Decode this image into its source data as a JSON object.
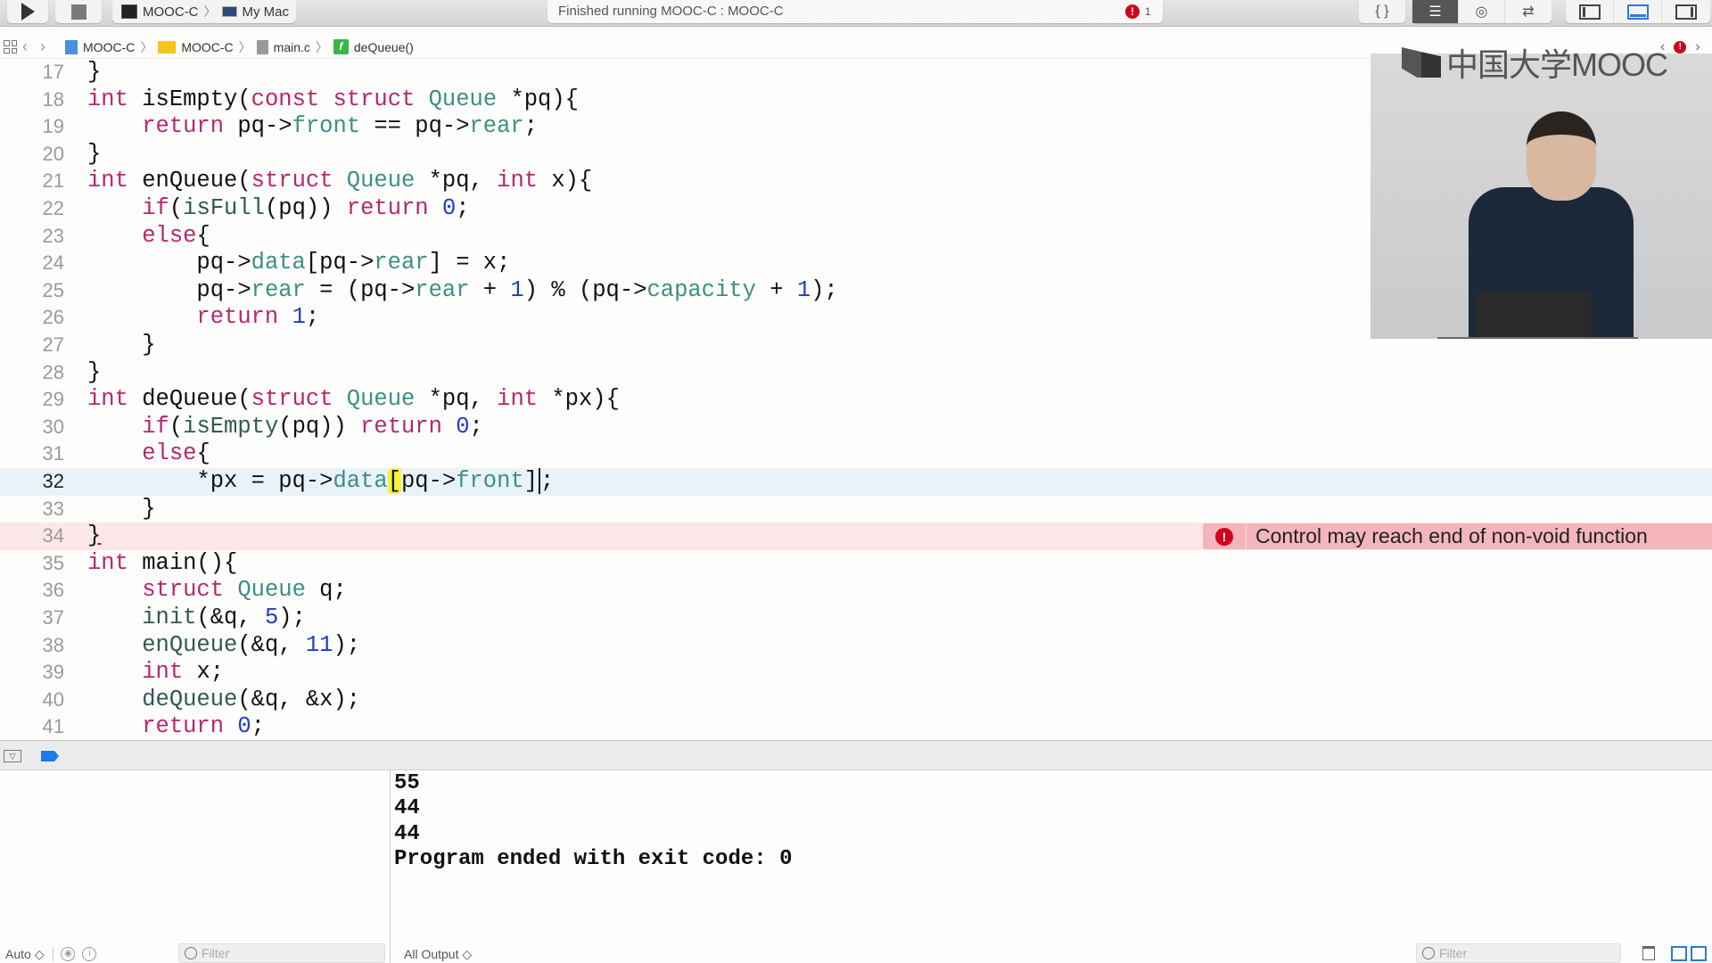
{
  "toolbar": {
    "run_icon": "play-icon",
    "stop_icon": "stop-icon",
    "scheme": "MOOC-C",
    "destination": "My Mac",
    "status": "Finished running MOOC-C : MOOC-C",
    "error_count": "1",
    "editor_modes": [
      "braces-icon",
      "standard-editor-icon",
      "assistant-editor-icon",
      "version-editor-icon"
    ],
    "active_editor_mode": "standard-editor-icon",
    "panel_toggles": [
      "navigator-panel-icon",
      "debug-panel-icon",
      "utilities-panel-icon"
    ],
    "active_panel": "debug-panel-icon"
  },
  "jumpbar": {
    "items": [
      "MOOC-C",
      "MOOC-C",
      "main.c",
      "deQueue()"
    ],
    "func_glyph": "f"
  },
  "editor": {
    "current_line": 32,
    "error_line": 34,
    "lines": [
      {
        "n": "17",
        "html": "}"
      },
      {
        "n": "18",
        "html": "<span class=\"kw\">int</span> isEmpty(<span class=\"kw\">const</span> <span class=\"kw\">struct</span> <span class=\"ty\">Queue</span> *pq){"
      },
      {
        "n": "19",
        "html": "    <span class=\"kw\">return</span> pq-&gt;<span class=\"mem\">front</span> == pq-&gt;<span class=\"mem\">rear</span>;"
      },
      {
        "n": "20",
        "html": "}"
      },
      {
        "n": "21",
        "html": "<span class=\"kw\">int</span> enQueue(<span class=\"kw\">struct</span> <span class=\"ty\">Queue</span> *pq, <span class=\"kw\">int</span> x){"
      },
      {
        "n": "22",
        "html": "    <span class=\"kw\">if</span>(<span class=\"fn\">isFull</span>(pq)) <span class=\"kw\">return</span> <span class=\"num\">0</span>;"
      },
      {
        "n": "23",
        "html": "    <span class=\"kw\">else</span>{"
      },
      {
        "n": "24",
        "html": "        pq-&gt;<span class=\"mem\">data</span>[pq-&gt;<span class=\"mem\">rear</span>] = x;"
      },
      {
        "n": "25",
        "html": "        pq-&gt;<span class=\"mem\">rear</span> = (pq-&gt;<span class=\"mem\">rear</span> + <span class=\"num\">1</span>) % (pq-&gt;<span class=\"mem\">capacity</span> + <span class=\"num\">1</span>);"
      },
      {
        "n": "26",
        "html": "        <span class=\"kw\">return</span> <span class=\"num\">1</span>;"
      },
      {
        "n": "27",
        "html": "    }"
      },
      {
        "n": "28",
        "html": "}"
      },
      {
        "n": "29",
        "html": "<span class=\"kw\">int</span> deQueue(<span class=\"kw\">struct</span> <span class=\"ty\">Queue</span> *pq, <span class=\"kw\">int</span> *px){"
      },
      {
        "n": "30",
        "html": "    <span class=\"kw\">if</span>(<span class=\"fn\">isEmpty</span>(pq)) <span class=\"kw\">return</span> <span class=\"num\">0</span>;"
      },
      {
        "n": "31",
        "html": "    <span class=\"kw\">else</span>{"
      },
      {
        "n": "32",
        "html": "        *px = pq-&gt;<span class=\"mem\">data</span><span class=\"hl\">[</span>pq-&gt;<span class=\"mem\">front</span>]<span class=\"caret\"></span>;"
      },
      {
        "n": "33",
        "html": "    }"
      },
      {
        "n": "34",
        "html": "<span class=\"err-brace\">}</span>"
      },
      {
        "n": "35",
        "html": "<span class=\"kw\">int</span> main(){"
      },
      {
        "n": "36",
        "html": "    <span class=\"kw\">struct</span> <span class=\"ty\">Queue</span> q;"
      },
      {
        "n": "37",
        "html": "    <span class=\"fn\">init</span>(&amp;q, <span class=\"num\">5</span>);"
      },
      {
        "n": "38",
        "html": "    <span class=\"fn\">enQueue</span>(&amp;q, <span class=\"num\">11</span>);"
      },
      {
        "n": "39",
        "html": "    <span class=\"kw\">int</span> x;"
      },
      {
        "n": "40",
        "html": "    <span class=\"fn\">deQueue</span>(&amp;q, &amp;x);"
      },
      {
        "n": "41",
        "html": "    <span class=\"kw\">return</span> <span class=\"num\">0</span>;"
      }
    ],
    "issue": {
      "icon": "error-icon",
      "message": "Control may reach end of non-void function"
    }
  },
  "video_overlay": {
    "logo_text": "中国大学MOOC"
  },
  "debug": {
    "console_output": [
      "55",
      "44",
      "44",
      "Program ended with exit code: 0"
    ],
    "variables_scope": "Auto ◇",
    "variables_filter_placeholder": "Filter",
    "output_selector": "All Output ◇",
    "console_filter_placeholder": "Filter"
  },
  "colors": {
    "keyword": "#b6276d",
    "type": "#3c8f83",
    "number": "#1d3cd0",
    "current_line_bg": "#e9f2fb",
    "error_line_bg": "#fbe7e8",
    "error_badge_bg": "#f4b6bc",
    "error_red": "#d0021b",
    "accent_blue": "#1a7ae8"
  }
}
